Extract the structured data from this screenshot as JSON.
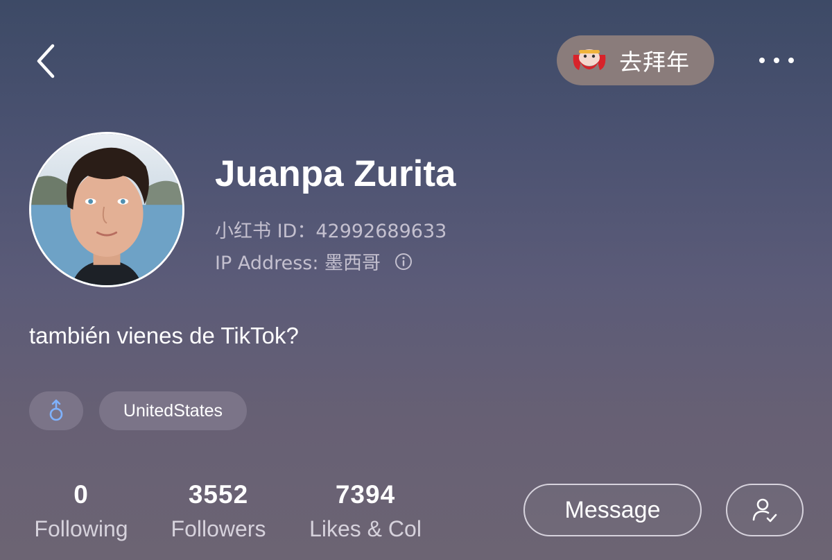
{
  "top_bar": {
    "back_icon": "chevron-left-icon",
    "new_year_button": {
      "icon": "lion-dance-icon",
      "label": "去拜年"
    },
    "more_icon": "more-horizontal-icon"
  },
  "profile": {
    "name": "Juanpa Zurita",
    "user_id": "小红书 ID：42992689633",
    "ip_address": "IP Address: 墨西哥",
    "info_icon": "info-icon",
    "bio": "también viene﻿s de TikTok?",
    "tags": [
      {
        "type": "gender",
        "icon": "male-icon",
        "color": "#7fb2ff"
      },
      {
        "type": "location",
        "label": "UnitedStates"
      }
    ]
  },
  "stats": [
    {
      "value": "0",
      "label": "Following"
    },
    {
      "value": "3552",
      "label": "Followers"
    },
    {
      "value": "7394",
      "label": "Likes & Col"
    }
  ],
  "actions": {
    "message_label": "Message",
    "follow_icon": "user-check-icon"
  }
}
